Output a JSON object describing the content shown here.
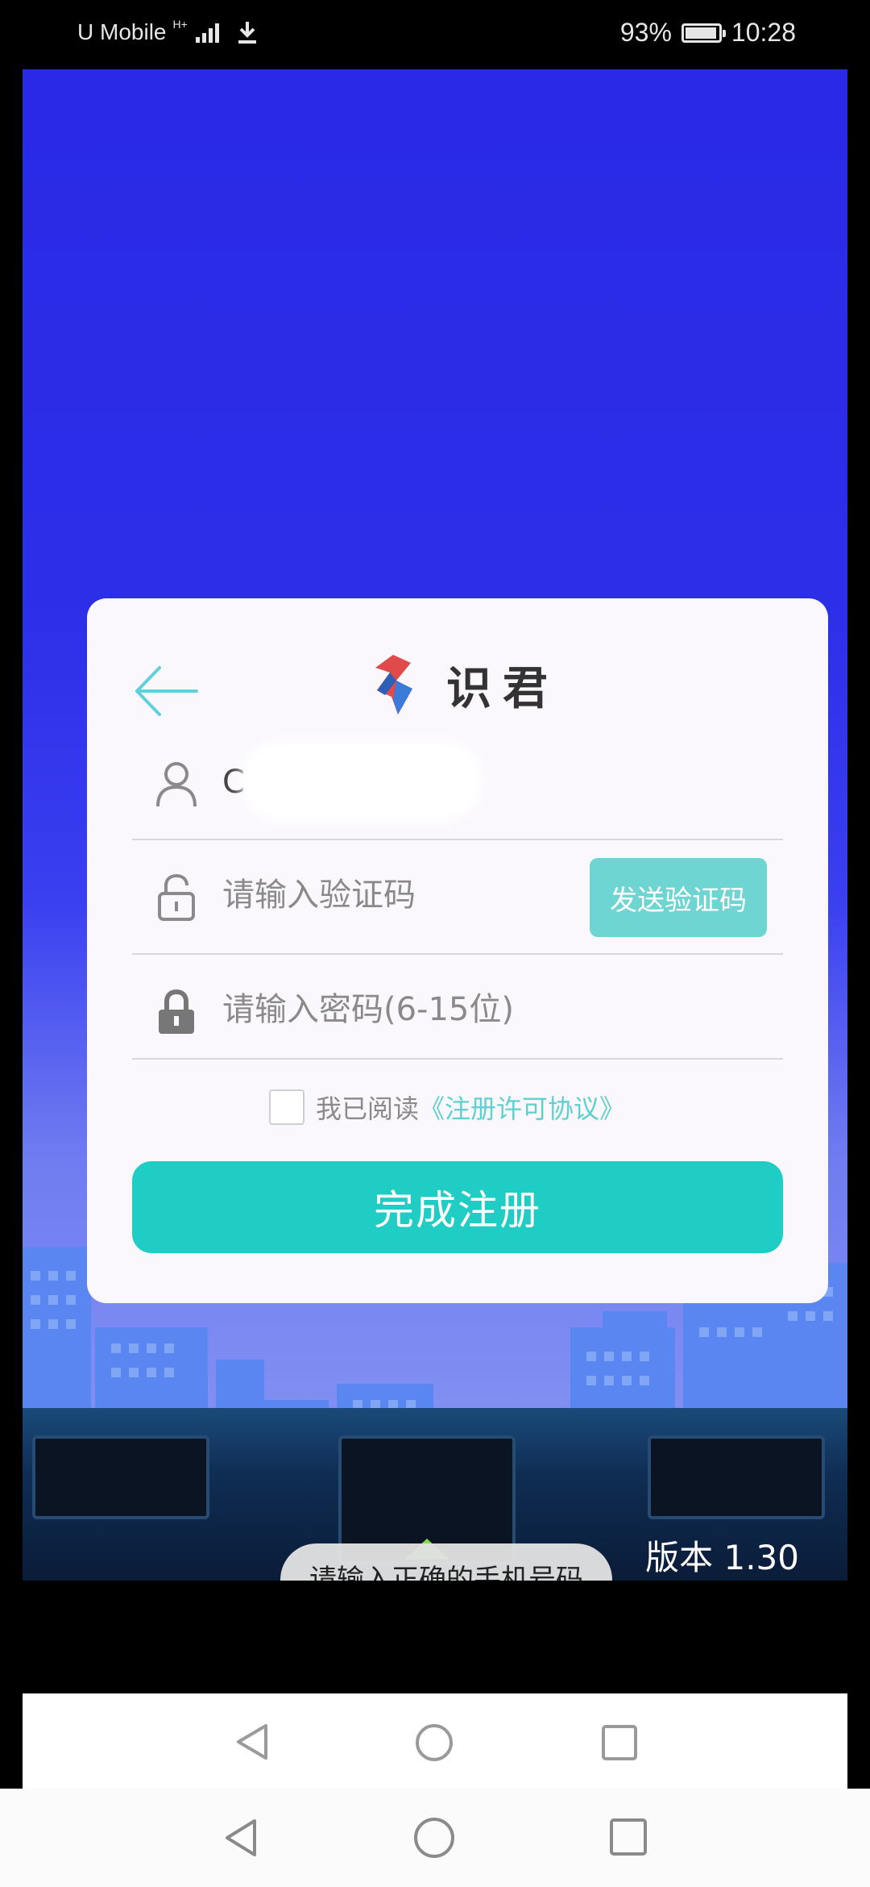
{
  "status_bar": {
    "carrier": "U Mobile",
    "network": "H+",
    "battery": "93%",
    "time": "10:28"
  },
  "brand": {
    "name": "识君",
    "accent": "#20cdc4",
    "light_accent": "#6fd5d2"
  },
  "form": {
    "phone_value": "C",
    "code_placeholder": "请输入验证码",
    "send_code_label": "发送验证码",
    "password_placeholder": "请输入密码(6-15位)",
    "agree_prefix": "我已阅读",
    "agree_link": "《注册许可协议》",
    "agree_checked": false,
    "submit_label": "完成注册"
  },
  "toast": "请输入正确的手机号码",
  "version": "版本 1.30",
  "icons": {
    "back": "back-arrow-icon",
    "user": "user-icon",
    "lock_open": "lock-open-icon",
    "lock": "lock-icon",
    "nav_back": "triangle-back-icon",
    "nav_home": "circle-home-icon",
    "nav_recent": "square-recent-icon"
  }
}
